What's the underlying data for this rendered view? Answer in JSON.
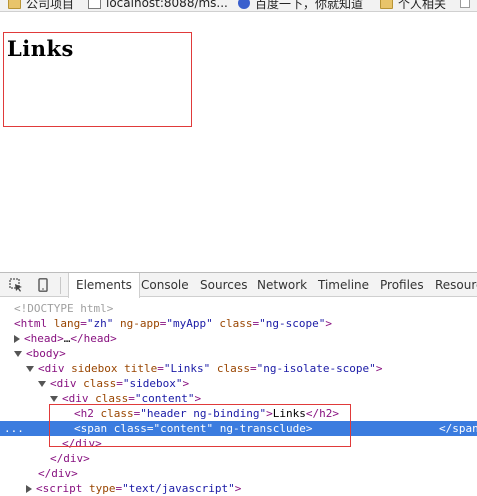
{
  "bookmarks": [
    {
      "label": "公司项目",
      "icon": "folder-icon"
    },
    {
      "label": "localhost:8088/ms...",
      "icon": "page-icon"
    },
    {
      "label": "百度一下，你就知道",
      "icon": "baidu-icon"
    },
    {
      "label": "个人相关",
      "icon": "folder-icon"
    }
  ],
  "page": {
    "heading": "Links"
  },
  "devtools": {
    "tabs": [
      "Elements",
      "Console",
      "Sources",
      "Network",
      "Timeline",
      "Profiles",
      "Resources"
    ],
    "active_tab": "Elements",
    "dom": {
      "doctype": "<!DOCTYPE html>",
      "html_open": {
        "tag": "<html",
        "attrs": [
          [
            "lang",
            "\"zh\""
          ],
          [
            "ng-app",
            "\"myApp\""
          ],
          [
            "class",
            "\"ng-scope\""
          ]
        ],
        "end": ">"
      },
      "head": {
        "open": "<head>",
        "dots": "…",
        "close": "</head>"
      },
      "body_open": "<body>",
      "div_sidebox": {
        "tag": "<div",
        "attrs": [
          [
            "sidebox",
            ""
          ],
          [
            "title",
            "\"Links\""
          ],
          [
            "class",
            "\"ng-isolate-scope\""
          ]
        ],
        "end": ">"
      },
      "div_sidebox_class": {
        "tag": "<div",
        "attrs": [
          [
            "class",
            "\"sidebox\""
          ]
        ],
        "end": ">"
      },
      "div_content": {
        "tag": "<div",
        "attrs": [
          [
            "class",
            "\"content\""
          ]
        ],
        "end": ">"
      },
      "h2": {
        "tag": "<h2",
        "attrs": [
          [
            "class",
            "\"header ng-binding\""
          ]
        ],
        "end": ">",
        "text": "Links",
        "close": "</h2>"
      },
      "span": {
        "tag": "<span",
        "attrs": [
          [
            "class",
            "\"content\""
          ],
          [
            "ng-transclude",
            ""
          ]
        ],
        "end": ">",
        "close": "</span>"
      },
      "div_close": "</div>",
      "script_open": {
        "tag": "<script",
        "attrs": [
          [
            "type",
            "\"text/javascript\""
          ]
        ],
        "end": ">"
      }
    },
    "ellipsis": "..."
  },
  "colors": {
    "selection": "#3b7cdf",
    "highlight_box": "#e03a3a",
    "tag": "#881280",
    "attr": "#994500",
    "value": "#1a1aa6"
  }
}
